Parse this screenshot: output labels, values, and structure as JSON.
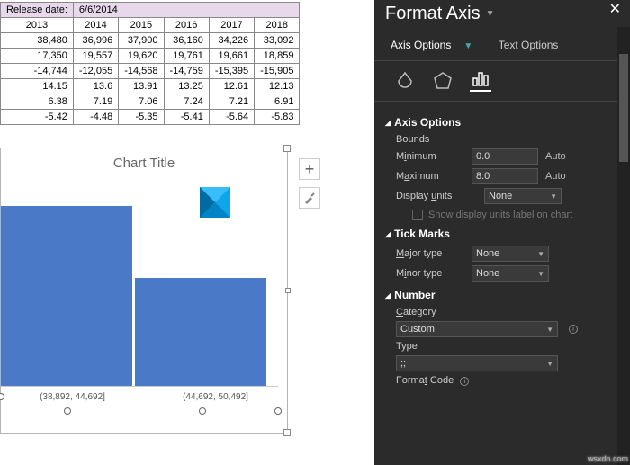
{
  "table": {
    "caption_label": "Release date:",
    "caption_value": "6/6/2014",
    "years": [
      "2013",
      "2014",
      "2015",
      "2016",
      "2017",
      "2018"
    ],
    "rows": [
      [
        "38,480",
        "36,996",
        "37,900",
        "36,160",
        "34,226",
        "33,092"
      ],
      [
        "17,350",
        "19,557",
        "19,620",
        "19,761",
        "19,661",
        "18,859"
      ],
      [
        "-14,744",
        "-12,055",
        "-14,568",
        "-14,759",
        "-15,395",
        "-15,905"
      ],
      [
        "14.15",
        "13.6",
        "13.91",
        "13.25",
        "12.61",
        "12.13"
      ],
      [
        "6.38",
        "7.19",
        "7.06",
        "7.24",
        "7.21",
        "6.91"
      ],
      [
        "-5.42",
        "-4.48",
        "-5.35",
        "-5.41",
        "-5.64",
        "-5.83"
      ]
    ]
  },
  "chart_data": {
    "type": "bar",
    "title": "Chart Title",
    "categories": [
      "(38,892, 44,692]",
      "(44,692, 50,492]"
    ],
    "values": [
      5,
      3
    ],
    "ylim": [
      0,
      8
    ]
  },
  "panel": {
    "title": "Format Axis",
    "tab_axis_options": "Axis Options",
    "tab_text_options": "Text Options",
    "sec_axis_options": "Axis Options",
    "bounds_label": "Bounds",
    "minimum_label": "Minimum",
    "minimum_value": "0.0",
    "maximum_label": "Maximum",
    "maximum_value": "8.0",
    "auto_label": "Auto",
    "display_units_label": "Display units",
    "display_units_value": "None",
    "show_units_checkbox": "Show display units label on chart",
    "sec_tick_marks": "Tick Marks",
    "major_type_label": "Major type",
    "major_type_value": "None",
    "minor_type_label": "Minor type",
    "minor_type_value": "None",
    "sec_number": "Number",
    "category_label": "Category",
    "category_value": "Custom",
    "type_label": "Type",
    "type_value": ";;",
    "format_code_label": "Format Code"
  },
  "watermark": "wsxdn.com"
}
